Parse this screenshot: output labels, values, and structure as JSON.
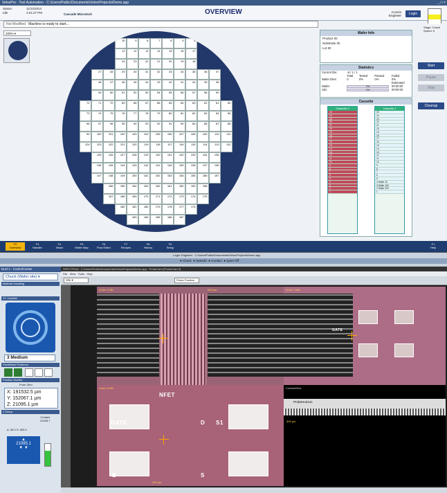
{
  "app": {
    "title": "VeloxPro - Tool Automation - C:\\Users\\Public\\Documents\\Velox\\Projects\\Demo.app",
    "window_buttons": "_ □ ×"
  },
  "header": {
    "status_label": "Status:",
    "status_value": "Idle",
    "date": "11/12/2014",
    "time": "4:01:27 PM",
    "brand": "Cascade Microtech",
    "page_title": "OVERVIEW",
    "access_label": "Access",
    "access_value": "Engineer",
    "login_label": "Login",
    "stage_label": "Stage: Chuck",
    "speed_label": "Speed: 5"
  },
  "message": {
    "label": "Not Modified",
    "text": "Machine is ready to start..."
  },
  "zoom": {
    "value": "200%"
  },
  "wafer_info": {
    "title": "Wafer Info",
    "product_id": "Product ID:",
    "substrate_id": "Substrate ID:",
    "lot_id": "Lot ID:"
  },
  "statistics": {
    "title": "Statistics",
    "current_die_label": "Current Die:",
    "current_die_value": "-6 / 1 / 1",
    "wafer_dies": "Wafer Dies:",
    "cols": [
      "Total",
      "Tested",
      "Passed",
      "Failed"
    ],
    "vals": [
      "0",
      "0%",
      "0%",
      "0%"
    ],
    "estimated": "Estimated",
    "wafer": "Wafer:",
    "job": "Job:",
    "wafer_pct": "0%",
    "job_pct": "0%",
    "wafer_time": "00:00:00",
    "job_time": "00:00:00"
  },
  "cassette": {
    "title": "Cassette",
    "cassette2": "Cassette 2",
    "cassette1": "Cassette 1",
    "slots2": [
      "25",
      "24",
      "23",
      "22",
      "21",
      "20",
      "19",
      "18",
      "17",
      "16",
      "15",
      "14",
      "13",
      "12",
      "11",
      "10",
      "9",
      "8",
      "7",
      "6",
      "5",
      "4",
      "3",
      "2",
      "1"
    ],
    "slots1": [
      "25",
      "24",
      "23",
      "22",
      "21",
      "20",
      "19",
      "18",
      "17",
      "16",
      "15",
      "14",
      "13",
      "12",
      "11",
      "10",
      "9",
      "8",
      "7",
      "6",
      "5",
      "4",
      "3",
      "2",
      "1"
    ],
    "slot1_tags": [
      "Wafer 10",
      "Wafer 100",
      "Wafer 200"
    ]
  },
  "right_buttons": {
    "start": "Start",
    "pause": "Pause",
    "stop": "Stop",
    "cleanup": "Cleanup"
  },
  "function_keys": [
    {
      "key": "F2",
      "label": "Overview"
    },
    {
      "key": "F3",
      "label": "Handler"
    },
    {
      "key": "F4",
      "label": "Vision"
    },
    {
      "key": "F5",
      "label": "Wafer Map"
    },
    {
      "key": "F6",
      "label": "Flow Editor"
    },
    {
      "key": "F7",
      "label": "Recipes"
    },
    {
      "key": "F8",
      "label": "History"
    },
    {
      "key": "F9",
      "label": "Setup"
    },
    {
      "key": "F1",
      "label": "Help"
    }
  ],
  "bottom_bar": {
    "login": "Login: Engineer",
    "path": "C:\\Users\\Public\\Documents\\Velox\\Projects\\Demo.app",
    "chuck": "Chuck",
    "speed": "Speed3",
    "contact": "Contact",
    "quiet": "Quiet Off"
  },
  "control_center": {
    "title": "Nucl 1 - ControlCenter",
    "chuck_select": "Chuck (Wafer site)",
    "material_handling": "Material Handling",
    "xy_joystick": "XY Joystick",
    "speed": "3 Medium",
    "predefined": "Predefined Positions",
    "position_monitor": "Position Monitor",
    "from_zero": "From Zero",
    "x_label": "X:",
    "x_val": "191532.5 µm",
    "y_label": "Y:",
    "y_val": "152067.1 µm",
    "z_label": "Z:",
    "z_val": "21095.1 µm",
    "z_setup": "Z Setup",
    "contact_label": "Contact",
    "contact_val": "21095.7",
    "a_val": "A: 36.0",
    "s_val": "S: 500.0",
    "z_big": "21095.1",
    "fill_pct": 0.7
  },
  "spectrum": {
    "title": "SPECTRUM - C:\\Users\\Public\\Documents\\Velox\\Projects\\Demo.app - ProbeCard (ProbeCard 2)",
    "menu": [
      "File",
      "View",
      "Tools",
      "Help"
    ],
    "zoom": "10x",
    "probe_position": "Probe Position",
    "view1": "eVue: 0.26x",
    "view2": "eVue: 2.00x",
    "view3": "eVue: 5.00x",
    "view4": "ContactView",
    "scale1": "500 µm",
    "scale2": "200 µm",
    "scale3": "300 µm",
    "probe_horizon": "ProbeHorizon",
    "gate": "GATE",
    "nfet": "NFET",
    "d_label": "D",
    "s1_label": "S1",
    "s_label": "S",
    "b_label": "B"
  },
  "wafer_grid": {
    "rows": [
      [
        "10",
        "9",
        "8",
        "7",
        "6",
        "5",
        "4"
      ],
      [
        "11",
        "12",
        "13",
        "14",
        "15",
        "16",
        "17"
      ],
      [
        "24",
        "23",
        "22",
        "21",
        "20",
        "19",
        "18"
      ],
      [
        "27",
        "28",
        "29",
        "30",
        "31",
        "32",
        "33",
        "34",
        "35",
        "36",
        "37"
      ],
      [
        "48",
        "47",
        "46",
        "45",
        "44",
        "43",
        "42",
        "41",
        "40",
        "39",
        "38"
      ],
      [
        "49",
        "50",
        "51",
        "52",
        "53",
        "54",
        "55",
        "56",
        "57",
        "58",
        "59"
      ],
      [
        "72",
        "71",
        "70",
        "69",
        "68",
        "67",
        "66",
        "65",
        "64",
        "63",
        "62",
        "61",
        "60"
      ],
      [
        "73",
        "74",
        "75",
        "76",
        "77",
        "78",
        "79",
        "80",
        "81",
        "82",
        "83",
        "84",
        "85"
      ],
      [
        "98",
        "97",
        "96",
        "95",
        "94",
        "93",
        "92",
        "91",
        "90",
        "89",
        "88",
        "87",
        "86"
      ],
      [
        "99",
        "100",
        "101",
        "102",
        "103",
        "104",
        "105",
        "106",
        "107",
        "108",
        "109",
        "110",
        "111"
      ],
      [
        "124",
        "123",
        "122",
        "121",
        "120",
        "119",
        "118",
        "117",
        "116",
        "115",
        "114",
        "113",
        "112"
      ],
      [
        "125",
        "126",
        "127",
        "128",
        "129",
        "130",
        "131",
        "132",
        "133",
        "134",
        "135"
      ],
      [
        "146",
        "145",
        "144",
        "143",
        "142",
        "141",
        "140",
        "139",
        "138",
        "137",
        "136"
      ],
      [
        "147",
        "148",
        "149",
        "150",
        "151",
        "152",
        "153",
        "154",
        "155",
        "156",
        "157"
      ],
      [
        "166",
        "165",
        "164",
        "163",
        "162",
        "161",
        "160",
        "159",
        "158"
      ],
      [
        "167",
        "168",
        "169",
        "170",
        "171",
        "172",
        "173",
        "174",
        "175"
      ],
      [
        "182",
        "181",
        "180",
        "179",
        "178",
        "177",
        "176"
      ],
      [
        "183",
        "184",
        "185",
        "186",
        "187"
      ]
    ]
  }
}
